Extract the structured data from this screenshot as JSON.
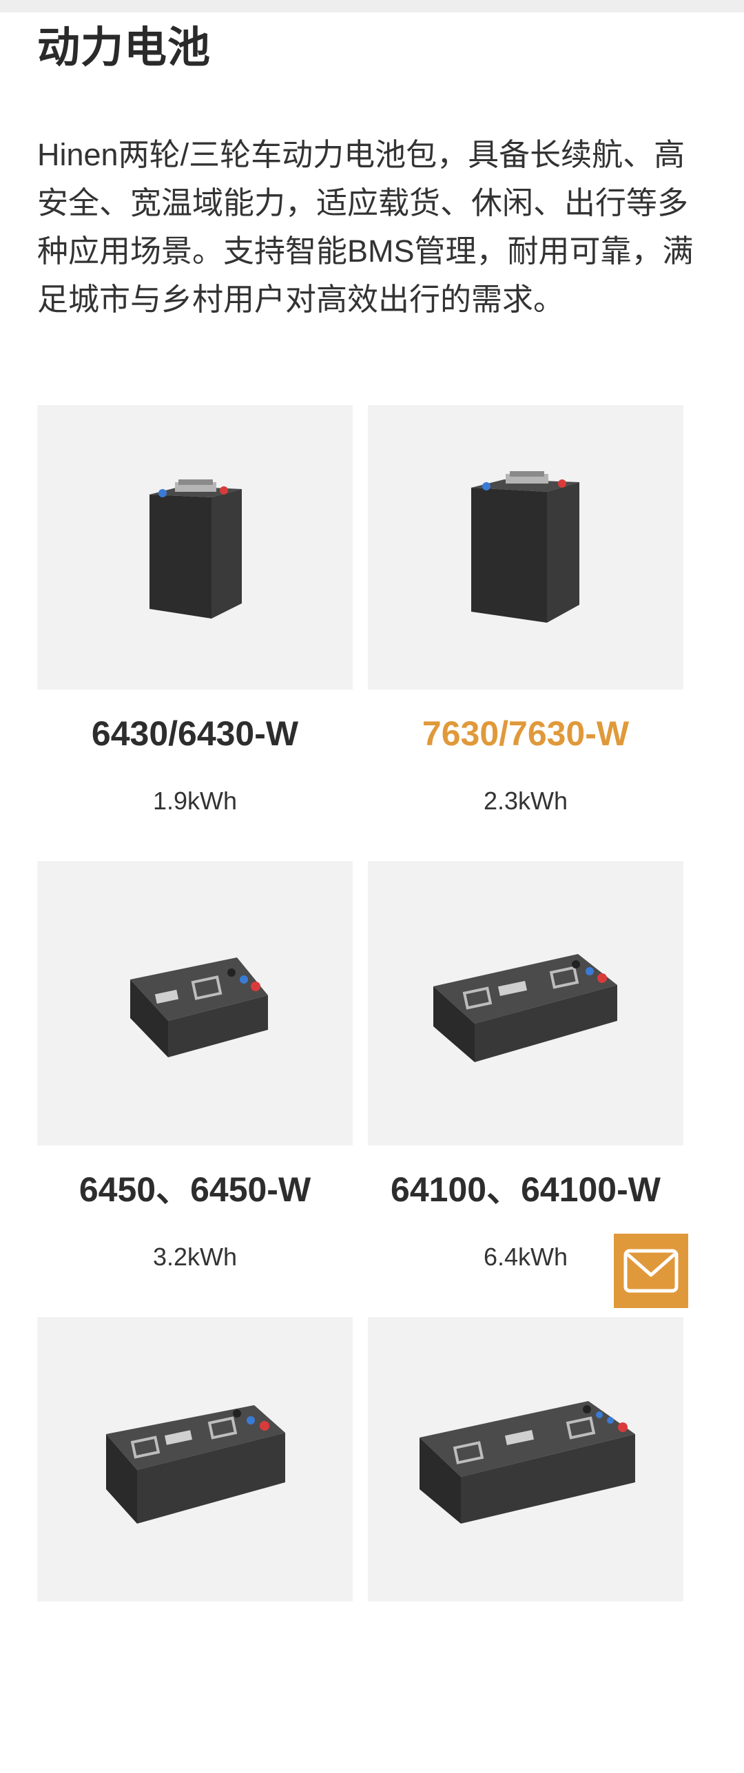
{
  "page": {
    "title": "动力电池",
    "description": "Hinen两轮/三轮车动力电池包，具备长续航、高安全、宽温域能力，适应载货、休闲、出行等多种应用场景。支持智能BMS管理，耐用可靠，满足城市与乡村用户对高效出行的需求。"
  },
  "products": [
    {
      "model": "6430/6430-W",
      "capacity": "1.9kWh",
      "image": "battery-tall-icon",
      "active": false
    },
    {
      "model": "7630/7630-W",
      "capacity": "2.3kWh",
      "image": "battery-tall-icon",
      "active": true
    },
    {
      "model": "6450、6450-W",
      "capacity": "3.2kWh",
      "image": "battery-flat-icon",
      "active": false
    },
    {
      "model": "64100、64100-W",
      "capacity": "6.4kWh",
      "image": "battery-flat-icon",
      "active": false
    },
    {
      "model": "",
      "capacity": "",
      "image": "battery-flat-icon",
      "active": false
    },
    {
      "model": "",
      "capacity": "",
      "image": "battery-flat-icon",
      "active": false
    }
  ],
  "colors": {
    "accent": "#e0993a",
    "card_bg": "#f2f2f2",
    "text": "#2b2b2b"
  },
  "floating": {
    "icon": "mail-icon"
  }
}
